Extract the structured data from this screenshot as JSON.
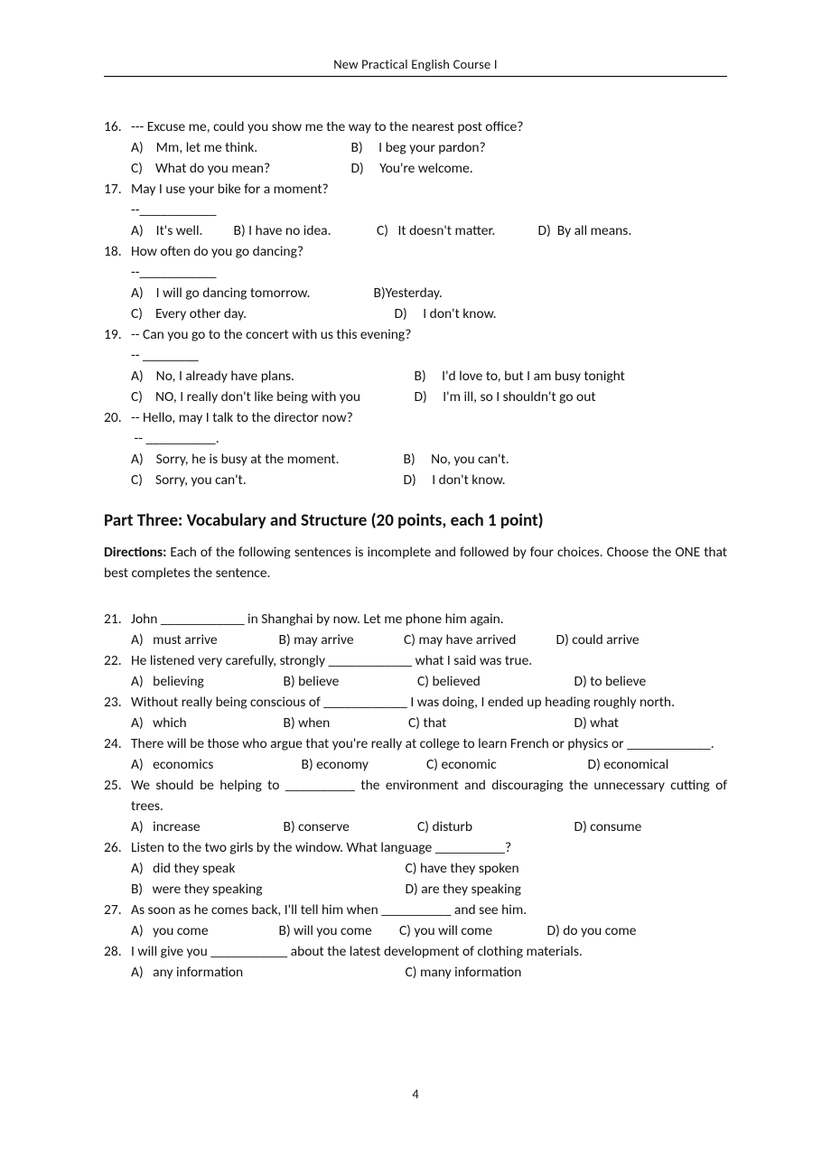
{
  "header": "New Practical English Course I",
  "pageNumber": "4",
  "q16": {
    "num": "16.",
    "text": "--- Excuse me, could you show me the way to the nearest post office?",
    "a": "A)    Mm, let me think.",
    "b": "B)     I beg your pardon?",
    "c": "C)    What do you mean?",
    "d": "D)     You're welcome."
  },
  "q17": {
    "num": "17.",
    "text": "May I use your bike for a moment?",
    "blank": "--___________",
    "a": "A)    It's well.",
    "b": "B) I have no idea.",
    "c": "C)   It doesn't matter.",
    "d": "D)  By all means."
  },
  "q18": {
    "num": "18.",
    "text": "How often do you go dancing?",
    "blank": "--___________",
    "a": "A)    I will go dancing tomorrow.",
    "b": "B)Yesterday.",
    "c": "C)    Every other day.",
    "d": "D)     I don't know."
  },
  "q19": {
    "num": "19.",
    "text": "-- Can you go to the concert with us this evening?",
    "blank": "-- ________",
    "a": "A)    No, I already have plans.",
    "b": "B)     I'd love to, but I am busy tonight",
    "c": "C)    NO, I really don't like being with you",
    "d": "D)     I'm ill, so I shouldn't go out"
  },
  "q20": {
    "num": "20.",
    "text": "-- Hello, may I talk to the director now?",
    "blank": " -- __________.",
    "a": "A)    Sorry, he is busy at the moment.",
    "b": "B)     No, you can't.",
    "c": "C)    Sorry, you can't.",
    "d": "D)     I don't know."
  },
  "partThree": {
    "title": "Part Three: Vocabulary and Structure (20 points, each 1 point)",
    "dirLabel": "Directions:",
    "dirText": " Each of the following sentences is incomplete and followed by four choices. Choose the ONE that best completes the sentence."
  },
  "q21": {
    "num": "21.",
    "text": "John ____________ in Shanghai by now. Let me phone him again.",
    "a": "A)   must arrive",
    "b": "B) may arrive",
    "c": "C) may have arrived",
    "d": "D) could arrive"
  },
  "q22": {
    "num": "22.",
    "text": "He listened very carefully, strongly ____________ what I said was true.",
    "a": "A)   believing",
    "b": "B) believe",
    "c": "C) believed",
    "d": "D) to believe"
  },
  "q23": {
    "num": "23.",
    "text": "Without really being conscious of ____________ I was doing, I ended up heading roughly north.",
    "a": "A)   which",
    "b": "B) when",
    "c": "C) that",
    "d": "D) what"
  },
  "q24": {
    "num": "24.",
    "text": "There will be those who argue that you're really at college to learn French or physics or ____________.",
    "a": "A)   economics",
    "b": "B) economy",
    "c": "C) economic",
    "d": "D) economical"
  },
  "q25": {
    "num": "25.",
    "text": "We should be helping to __________ the environment and discouraging the unnecessary cutting of trees.",
    "a": "A)   increase",
    "b": "B) conserve",
    "c": "C) disturb",
    "d": "D) consume"
  },
  "q26": {
    "num": "26.",
    "text": "Listen to the two girls by the window. What language __________?",
    "a": "A)   did they speak",
    "b": "C) have they spoken",
    "c": "B)   were they speaking",
    "d": "D) are they speaking"
  },
  "q27": {
    "num": "27.",
    "text": "As soon as he comes back, I'll tell him when __________ and see him.",
    "a": "A)   you come",
    "b": "B) will you come",
    "c": "C) you will come",
    "d": "D) do you come"
  },
  "q28": {
    "num": "28.",
    "text": "I will give you ___________ about the latest development of clothing materials.",
    "a": "A)   any information",
    "b": "C) many information"
  }
}
